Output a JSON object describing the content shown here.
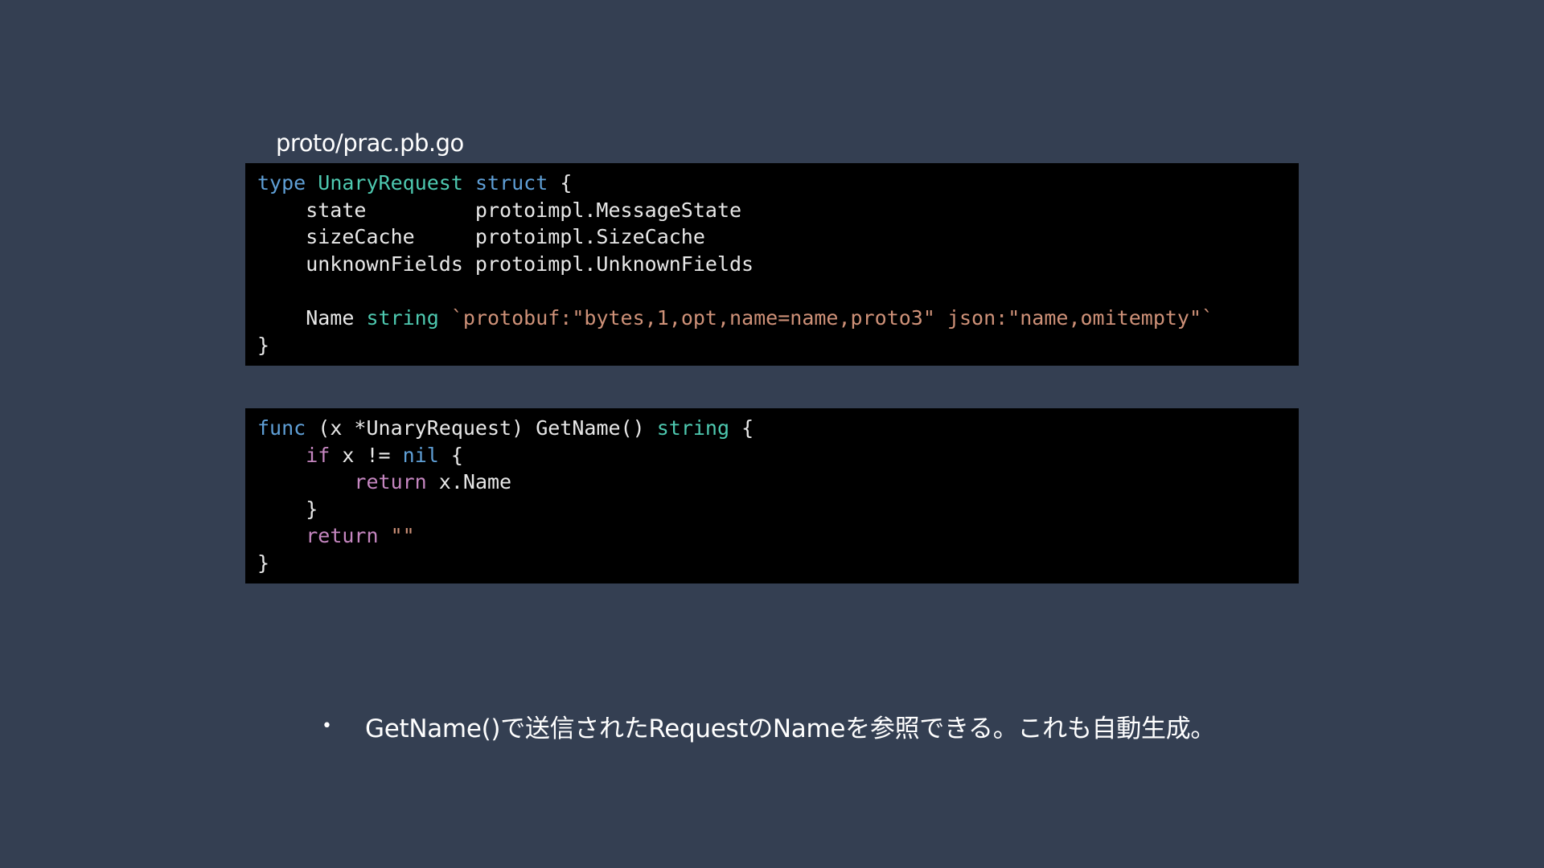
{
  "file_label": "proto/prac.pb.go",
  "colors": {
    "background": "#343f52",
    "code_background": "#000000",
    "default": "#e8e8e8",
    "keyword": "#5f9fd6",
    "type": "#4ec9b0",
    "control": "#c586c0",
    "string": "#ce9178"
  },
  "code_blocks": [
    {
      "lines": [
        [
          {
            "t": "type",
            "c": "keyword"
          },
          {
            "t": " ",
            "c": "default"
          },
          {
            "t": "UnaryRequest",
            "c": "type"
          },
          {
            "t": " ",
            "c": "default"
          },
          {
            "t": "struct",
            "c": "keyword"
          },
          {
            "t": " {",
            "c": "default"
          }
        ],
        [
          {
            "t": "    state         protoimpl.MessageState",
            "c": "default"
          }
        ],
        [
          {
            "t": "    sizeCache     protoimpl.SizeCache",
            "c": "default"
          }
        ],
        [
          {
            "t": "    unknownFields protoimpl.UnknownFields",
            "c": "default"
          }
        ],
        [],
        [
          {
            "t": "    Name ",
            "c": "default"
          },
          {
            "t": "string",
            "c": "type"
          },
          {
            "t": " ",
            "c": "default"
          },
          {
            "t": "`protobuf:\"bytes,1,opt,name=name,proto3\" json:\"name,omitempty\"`",
            "c": "string"
          }
        ],
        [
          {
            "t": "}",
            "c": "default"
          }
        ]
      ]
    },
    {
      "lines": [
        [
          {
            "t": "func",
            "c": "keyword"
          },
          {
            "t": " (x *UnaryRequest) GetName() ",
            "c": "default"
          },
          {
            "t": "string",
            "c": "type"
          },
          {
            "t": " {",
            "c": "default"
          }
        ],
        [
          {
            "t": "    ",
            "c": "default"
          },
          {
            "t": "if",
            "c": "control"
          },
          {
            "t": " x != ",
            "c": "default"
          },
          {
            "t": "nil",
            "c": "keyword"
          },
          {
            "t": " {",
            "c": "default"
          }
        ],
        [
          {
            "t": "        ",
            "c": "default"
          },
          {
            "t": "return",
            "c": "control"
          },
          {
            "t": " x.Name",
            "c": "default"
          }
        ],
        [
          {
            "t": "    }",
            "c": "default"
          }
        ],
        [
          {
            "t": "    ",
            "c": "default"
          },
          {
            "t": "return",
            "c": "control"
          },
          {
            "t": " ",
            "c": "default"
          },
          {
            "t": "\"\"",
            "c": "string"
          }
        ],
        [
          {
            "t": "}",
            "c": "default"
          }
        ]
      ]
    }
  ],
  "bullets": [
    {
      "marker": "•",
      "text": "GetName()で送信されたRequestのNameを参照できる。これも自動生成。"
    }
  ]
}
